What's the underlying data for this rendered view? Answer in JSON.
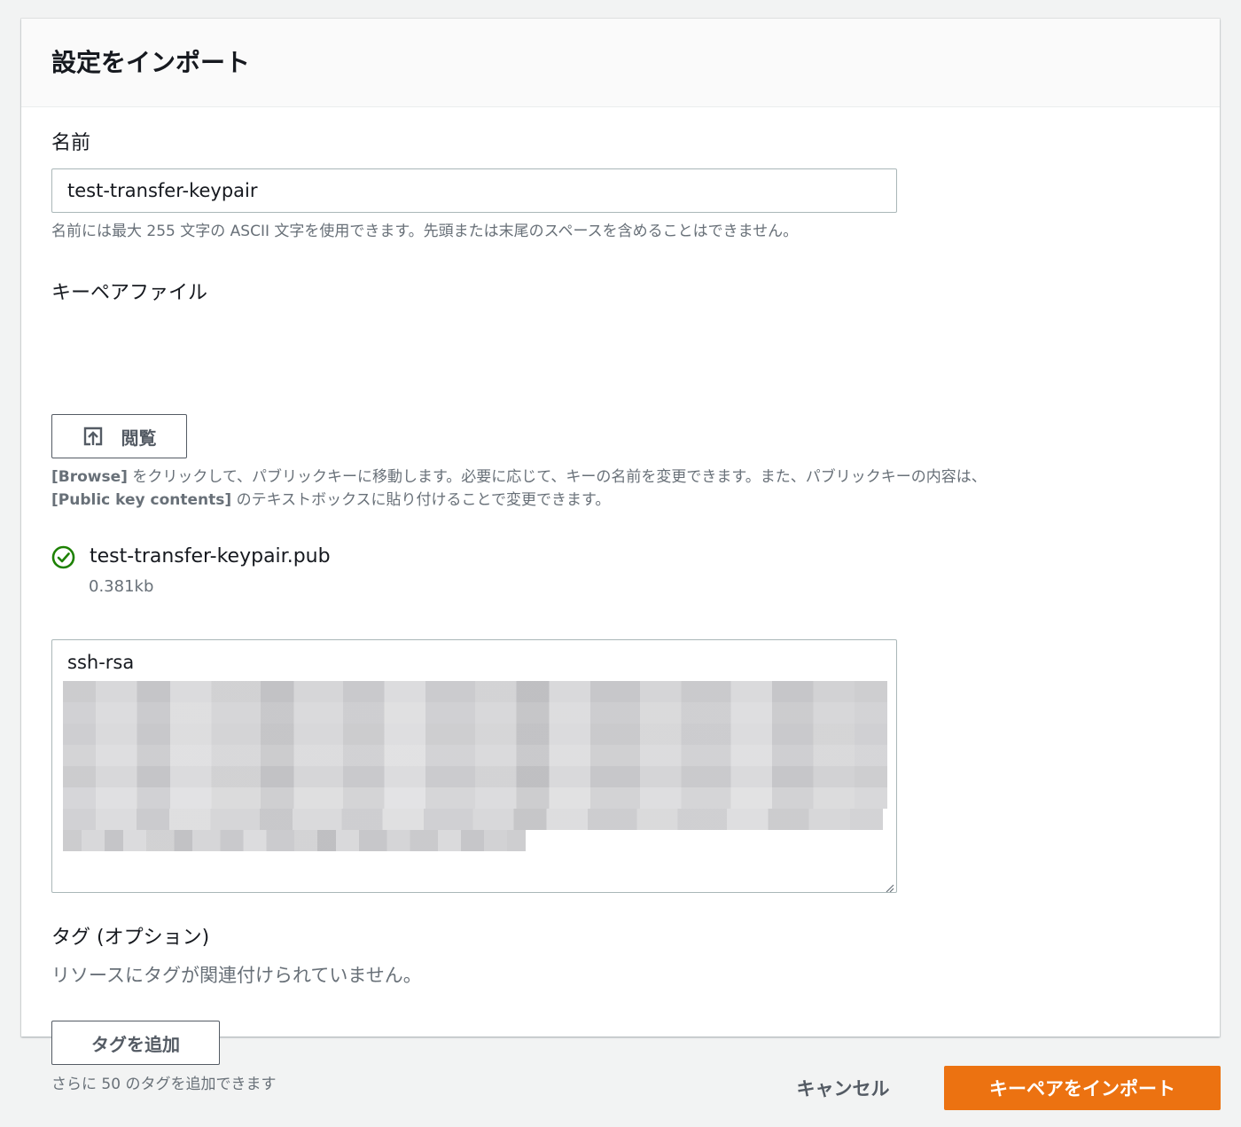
{
  "panel": {
    "title": "設定をインポート"
  },
  "name_field": {
    "label": "名前",
    "value": "test-transfer-keypair",
    "hint": "名前には最大 255 文字の ASCII 文字を使用できます。先頭または末尾のスペースを含めることはできません。"
  },
  "key_file": {
    "label": "キーペアファイル",
    "browse_label": "閲覧",
    "browse_icon": "upload-icon",
    "hint_part1_bold": "[Browse]",
    "hint_part1": " をクリックして、パブリックキーに移動します。必要に応じて、キーの名前を変更できます。また、パブリックキーの内容は、",
    "hint_part2_bold": "[Public key contents]",
    "hint_part2": " のテキストボックスに貼り付けることで変更できます。",
    "file_name": "test-transfer-keypair.pub",
    "file_size": "0.381kb",
    "file_status_icon": "check-circle-icon",
    "status_color": "#1d8102"
  },
  "public_key": {
    "visible_text": "ssh-rsa"
  },
  "tags": {
    "heading": "タグ (オプション)",
    "empty_message": "リソースにタグが関連付けられていません。",
    "add_label": "タグを追加",
    "remaining": "さらに 50 のタグを追加できます"
  },
  "footer": {
    "cancel_label": "キャンセル",
    "submit_label": "キーペアをインポート",
    "accent_color": "#ec7211"
  }
}
